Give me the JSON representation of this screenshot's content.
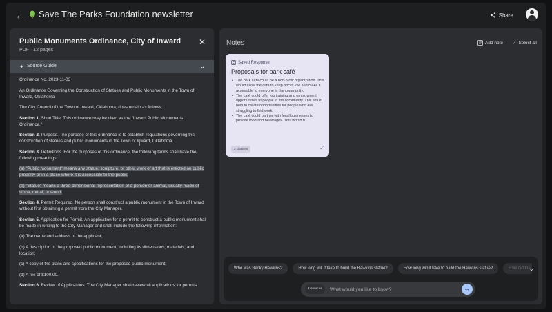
{
  "header": {
    "title": "Save The Parks Foundation newsletter",
    "share_label": "Share",
    "back_icon": "arrow-left-icon",
    "logo_icon": "leaf-logo-icon"
  },
  "source": {
    "title": "Public Monuments Ordinance, City of Inward",
    "meta": "PDF · 12 pages",
    "guide_label": "Source Guide",
    "paragraphs": [
      {
        "text": "Ordinance No. 2023-11-03"
      },
      {
        "text": "An Ordinance Governing the Construction of Statues and Public Monuments in the Town of Inward, Oklahoma"
      },
      {
        "text": "The City Council of the Town of Inward, Oklahoma, does ordain as follows:"
      },
      {
        "bold": "Section 1.",
        "text": " Short Title. This ordinance may be cited as the \"Inward Public Monuments Ordinance.\""
      },
      {
        "bold": "Section 2.",
        "text": " Purpose. The purpose of this ordinance is to establish regulations governing the construction of statues and public monuments in the Town of Inward, Oklahoma."
      },
      {
        "bold": "Section 3.",
        "text": " Definitions. For the purposes of this ordinance, the following terms shall have the following meanings:"
      },
      {
        "text": "(a) \"Public monument\" means any statue, sculpture, or other work of art that is erected on public property or in a place where it is accessible to the public.",
        "highlight": true
      },
      {
        "text": "(b) \"Statue\" means a three-dimensional representation of a person or animal, usually made of stone, metal, or wood.",
        "highlight": true
      },
      {
        "bold": "Section 4.",
        "text": " Permit Required. No person shall construct a public monument in the Town of Inward without first obtaining a permit from the City Manager."
      },
      {
        "bold": "Section 5.",
        "text": " Application for Permit. An application for a permit to construct a public monument shall be made in writing to the City Manager and shall include the following information:"
      },
      {
        "text": "(a) The name and address of the applicant;"
      },
      {
        "text": "(b) A description of the proposed public monument, including its dimensions, materials, and location;"
      },
      {
        "text": "(c) A copy of the plans and specifications for the proposed public monument;"
      },
      {
        "text": "(d) A fee of $100.00."
      },
      {
        "bold": "Section 6.",
        "text": " Review of Applications. The City Manager shall review all applications for permits"
      }
    ]
  },
  "notes": {
    "title": "Notes",
    "add_note_label": "Add note",
    "select_all_label": "Select all",
    "card": {
      "kind": "Saved Response",
      "title": "Proposals for park café",
      "bullets": [
        "The park café could be a non-profit organization. This would allow the café to keep prices low and make it accessible to everyone in the community.",
        "The café could offer job training and employment opportunities to people in the community. This would help to create opportunities for people who are struggling to find work.",
        "The café could partner with local businesses to provide food and beverages. This would h"
      ],
      "citations": "3 citations"
    }
  },
  "chat": {
    "suggestions": [
      "Who was Becky Hawkins?",
      "How long will it take to build the Hawkins statue?",
      "How long will it take to build the Hawkins statue?",
      "How did the"
    ],
    "sources_count": "4 sources",
    "placeholder": "What would you like to know?"
  }
}
